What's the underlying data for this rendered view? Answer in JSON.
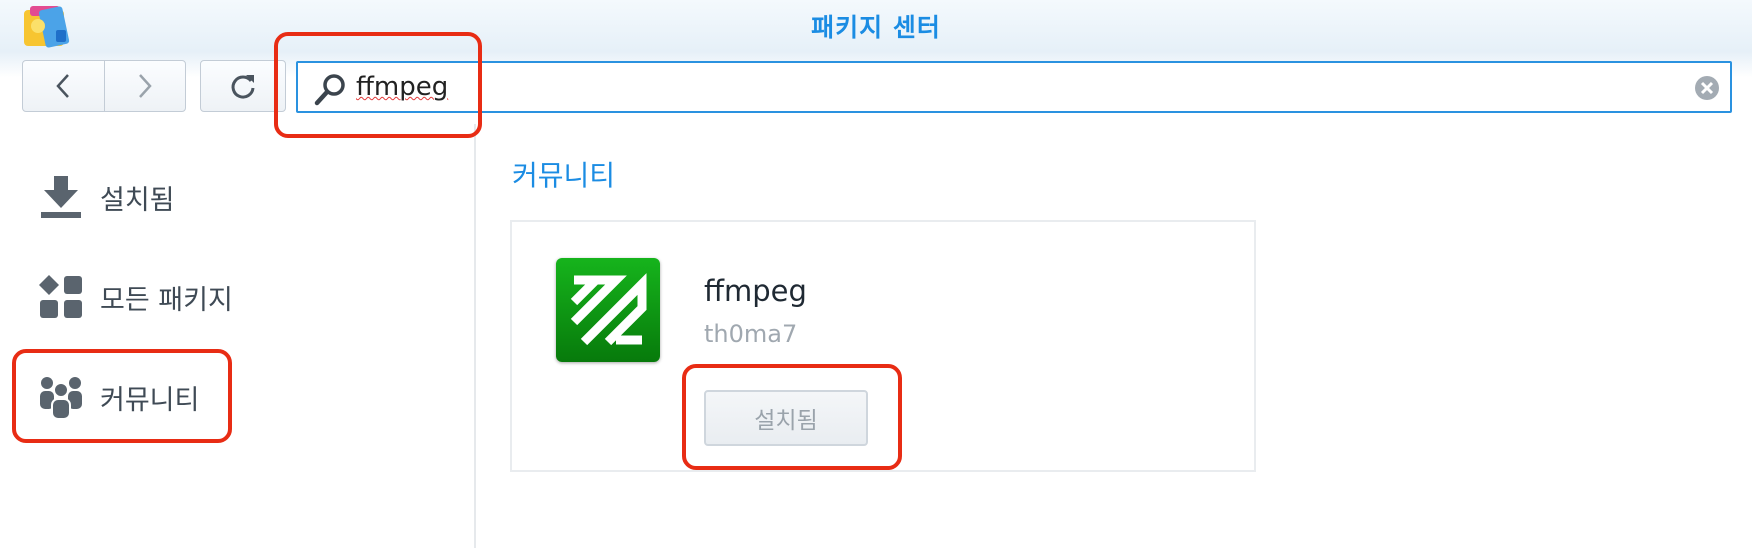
{
  "app": {
    "title": "패키지 센터"
  },
  "toolbar": {
    "back_icon": "chevron-left-icon",
    "forward_icon": "chevron-right-icon",
    "refresh_icon": "refresh-icon",
    "search": {
      "value": "ffmpeg",
      "placeholder": ""
    },
    "clear_icon": "clear-circle-icon"
  },
  "sidebar": {
    "items": [
      {
        "label": "설치됨",
        "icon": "download-tray-icon"
      },
      {
        "label": "모든 패키지",
        "icon": "grid-shapes-icon"
      },
      {
        "label": "커뮤니티",
        "icon": "people-icon",
        "selected": true
      }
    ]
  },
  "main": {
    "section_title": "커뮤니티",
    "packages": [
      {
        "name": "ffmpeg",
        "author": "th0ma7",
        "button_label": "설치됨",
        "button_disabled": true,
        "icon": "ffmpeg-logo-icon"
      }
    ]
  },
  "colors": {
    "accent": "#1b8ce3",
    "highlight": "#e82c14",
    "ffmpeg_green": "#0a9c10"
  }
}
